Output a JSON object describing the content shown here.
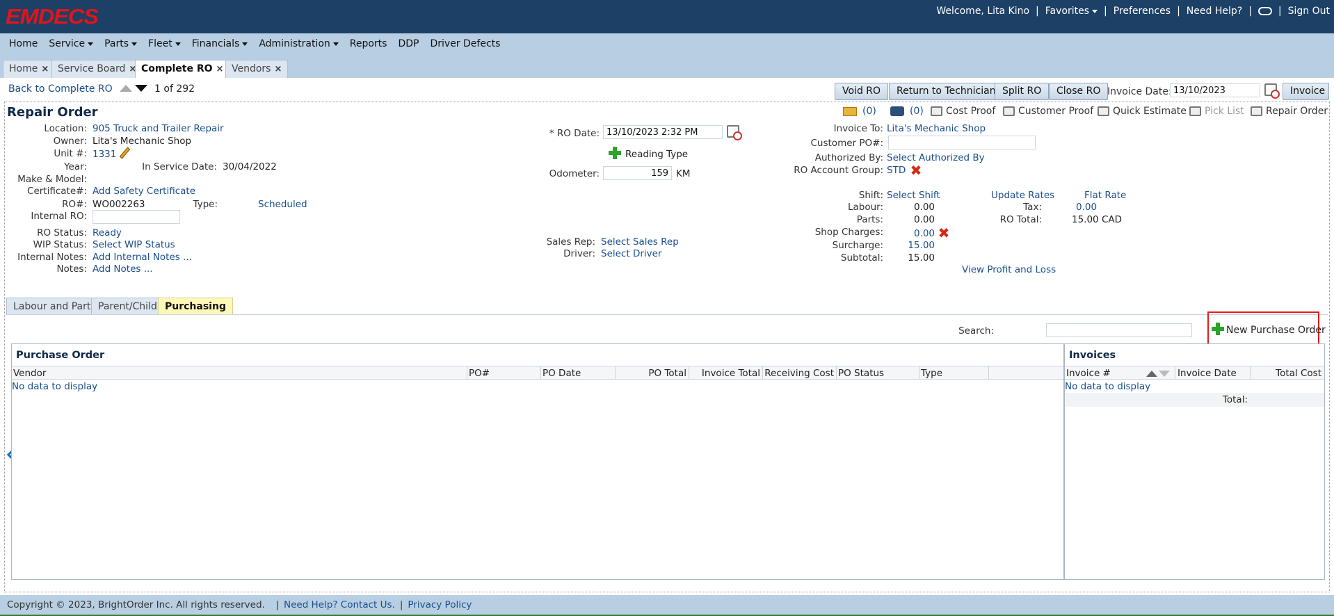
{
  "brand": {
    "logo": "EMDECS"
  },
  "topbar": {
    "welcome": "Welcome, Lita Kino",
    "favorites": "Favorites",
    "preferences": "Preferences",
    "help": "Need Help?",
    "signout": "Sign Out"
  },
  "menu": [
    "Home",
    "Service",
    "Parts",
    "Fleet",
    "Financials",
    "Administration",
    "Reports",
    "DDP",
    "Driver Defects"
  ],
  "tabs": [
    "Home",
    "Service Board",
    "Complete RO",
    "Vendors"
  ],
  "actions": {
    "back": "Back to Complete RO",
    "pager_current": "1",
    "pager_of": "of",
    "pager_total": "292",
    "void": "Void RO",
    "return": "Return to Technician",
    "split": "Split RO",
    "close": "Close RO",
    "invoice_date_label": "Invoice Date:",
    "invoice_date": "13/10/2023",
    "invoice": "Invoice"
  },
  "ro": {
    "title": "Repair Order",
    "mail_count": "(0)",
    "photo_count": "(0)",
    "cost_proof": "Cost Proof",
    "customer_proof": "Customer Proof",
    "quick_estimate": "Quick Estimate",
    "pick_list": "Pick List",
    "repair_order": "Repair Order",
    "location_label": "Location:",
    "location": "905 Truck and Trailer Repair",
    "owner_label": "Owner:",
    "owner": "Lita's Mechanic Shop",
    "unit_label": "Unit #:",
    "unit": "1331",
    "year_label": "Year:",
    "in_service_label": "In Service Date:",
    "in_service": "30/04/2022",
    "make_label": "Make & Model:",
    "cert_label": "Certificate#:",
    "cert": "Add Safety Certificate",
    "ro_no_label": "RO#:",
    "ro_no": "WO002263",
    "type_label": "Type:",
    "type": "Scheduled",
    "internal_ro_label": "Internal RO:",
    "status_label": "RO Status:",
    "status": "Ready",
    "wip_label": "WIP Status:",
    "wip": "Select WIP Status",
    "internal_notes_label": "Internal Notes:",
    "internal_notes": "Add Internal Notes ...",
    "notes_label": "Notes:",
    "notes": "Add Notes ...",
    "ro_date_label": "* RO Date:",
    "ro_date": "13/10/2023 2:32 PM",
    "reading_type": "Reading Type",
    "odometer_label": "Odometer:",
    "odometer": "159",
    "odometer_unit": "KM",
    "sales_rep_label": "Sales Rep:",
    "sales_rep": "Select Sales Rep",
    "driver_label": "Driver:",
    "driver": "Select Driver",
    "invoice_to_label": "Invoice To:",
    "invoice_to": "Lita's Mechanic Shop",
    "cust_po_label": "Customer PO#:",
    "authorized_label": "Authorized By:",
    "authorized": "Select Authorized By",
    "acct_group_label": "RO Account Group:",
    "acct_group": "STD",
    "shift_label": "Shift:",
    "shift": "Select Shift",
    "labour_label": "Labour:",
    "labour": "0.00",
    "parts_label": "Parts:",
    "parts": "0.00",
    "shop_label": "Shop Charges:",
    "shop": "0.00",
    "surcharge_label": "Surcharge:",
    "surcharge": "15.00",
    "subtotal_label": "Subtotal:",
    "subtotal": "15.00",
    "update_rates": "Update Rates",
    "flat_rate": "Flat Rate",
    "tax_label": "Tax:",
    "tax": "0.00",
    "total_label": "RO Total:",
    "total": "15.00 CAD",
    "profit_loss": "View Profit and Loss"
  },
  "subtabs": [
    "Labour and Parts",
    "Parent/Child",
    "Purchasing"
  ],
  "purchasing": {
    "search_label": "Search:",
    "new_po": "New Purchase Order",
    "po_title": "Purchase Order",
    "po_columns": [
      "Vendor",
      "PO#",
      "PO Date",
      "PO Total",
      "Invoice Total",
      "Receiving Cost",
      "PO Status",
      "Type"
    ],
    "po_empty": "No data to display",
    "inv_title": "Invoices",
    "inv_columns": [
      "Invoice #",
      "Invoice Date",
      "Total Cost"
    ],
    "inv_empty": "No data to display",
    "inv_total": "Total:"
  },
  "footer": {
    "copyright": "Copyright © 2023, BrightOrder Inc. All rights reserved.",
    "help": "Need Help? Contact Us.",
    "privacy": "Privacy Policy"
  }
}
